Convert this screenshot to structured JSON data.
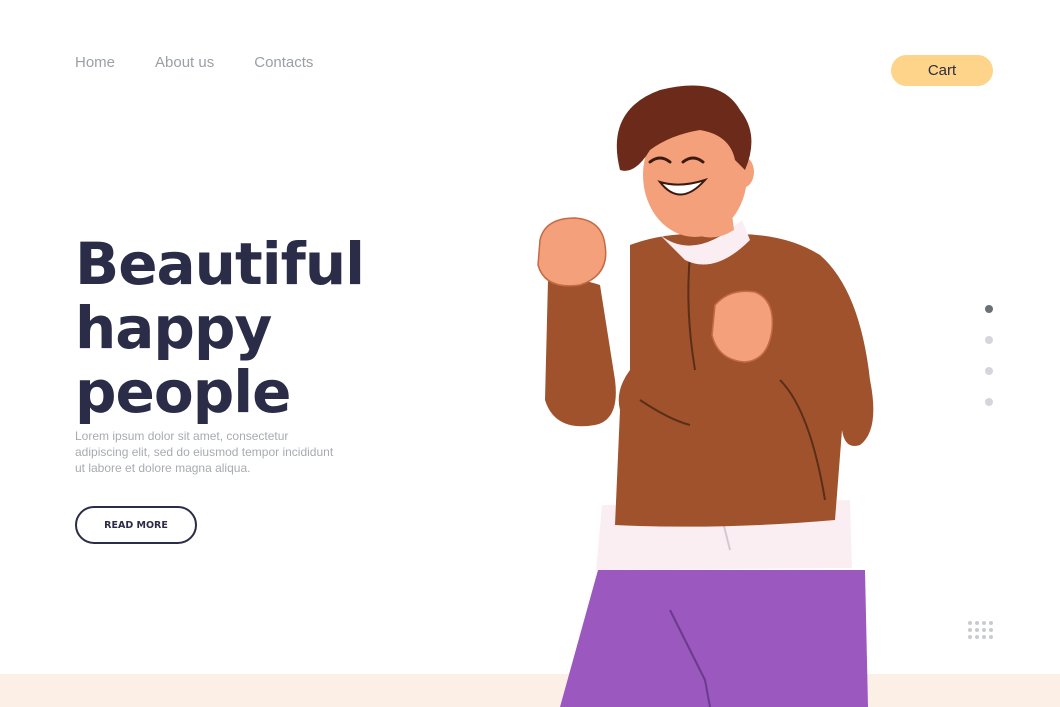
{
  "nav": {
    "items": [
      "Home",
      "About us",
      "Contacts"
    ]
  },
  "cart_label": "Cart",
  "hero": {
    "title_lines": [
      "Beautiful",
      "happy",
      "people"
    ],
    "body": "Lorem ipsum dolor sit amet, consectetur adipiscing elit, sed do eiusmod tempor incididunt ut labore et dolore magna aliqua.",
    "button_label": "READ MORE"
  },
  "slider": {
    "count": 4,
    "active_index": 0
  },
  "colors": {
    "accent": "#fdd48a",
    "heading": "#2b2d48",
    "sweater": "#a0522d",
    "pants": "#9b59c0",
    "floor": "#fcefe6"
  },
  "icons": [
    "slide-indicator-dots",
    "decorative-dot-grid"
  ],
  "illustration": "cheerful-man-celebrating"
}
